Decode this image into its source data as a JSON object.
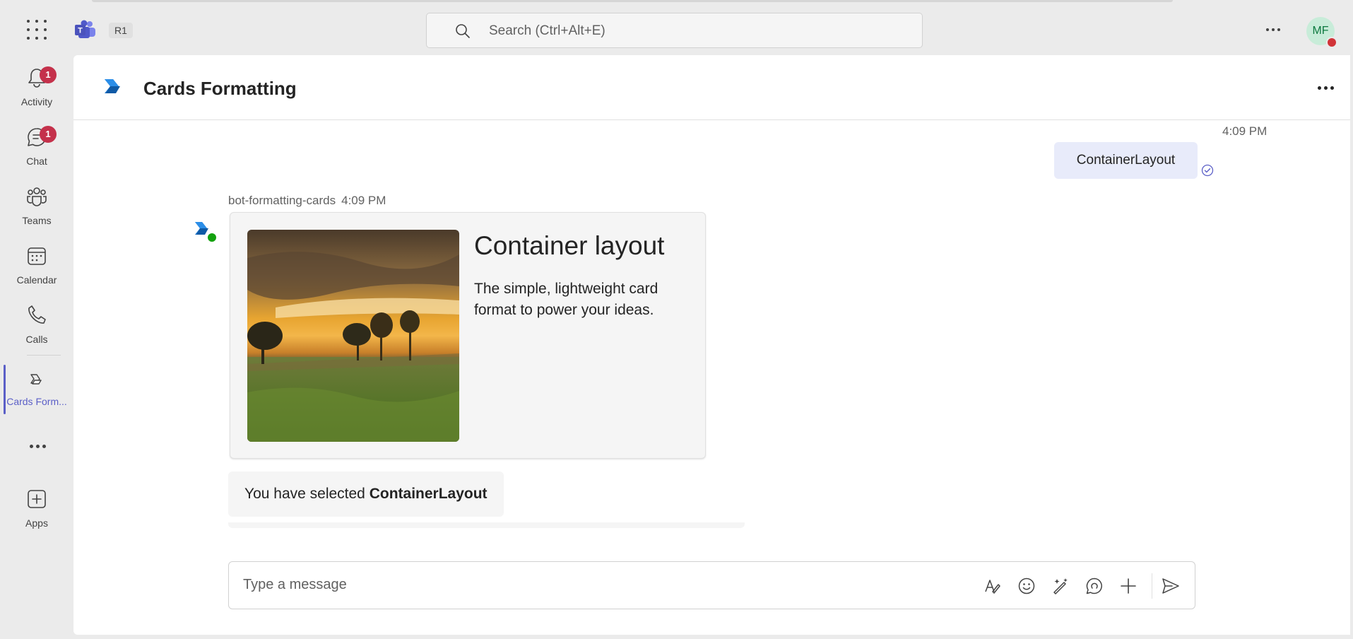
{
  "topbar": {
    "tenant_badge": "R1",
    "search_placeholder": "Search (Ctrl+Alt+E)",
    "avatar_initials": "MF"
  },
  "rail": {
    "items": [
      {
        "label": "Activity",
        "badge": "1",
        "icon": "bell-icon"
      },
      {
        "label": "Chat",
        "badge": "1",
        "icon": "chat-icon"
      },
      {
        "label": "Teams",
        "icon": "teams-icon"
      },
      {
        "label": "Calendar",
        "icon": "calendar-icon"
      },
      {
        "label": "Calls",
        "icon": "phone-icon"
      },
      {
        "label": "Cards Form...",
        "icon": "cards-formatting-app-icon",
        "active": true
      },
      {
        "label": "Apps",
        "icon": "add-apps-icon"
      }
    ]
  },
  "header": {
    "title": "Cards Formatting"
  },
  "conversation": {
    "sent": {
      "time": "4:09 PM",
      "text": "ContainerLayout"
    },
    "bot": {
      "name": "bot-formatting-cards",
      "time": "4:09 PM",
      "card": {
        "title": "Container layout",
        "text": "The simple, lightweight card format to power your ideas."
      },
      "reply_prefix": "You have selected ",
      "reply_bold": "ContainerLayout"
    }
  },
  "composer": {
    "placeholder": "Type a message"
  },
  "colors": {
    "accent": "#5b5fc7",
    "badge": "#c4314b",
    "sent_bubble": "#e8ebfa",
    "presence_busy": "#d13438",
    "presence_available": "#13a10e"
  }
}
